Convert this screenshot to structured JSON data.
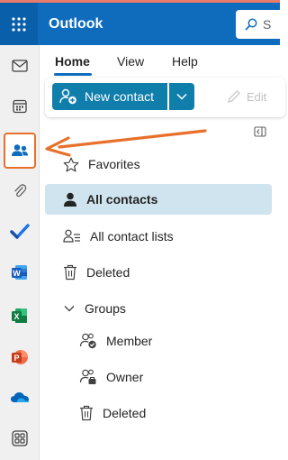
{
  "app": {
    "title": "Outlook"
  },
  "search": {
    "placeholder": "S"
  },
  "colors": {
    "brand": "#0f6cbd",
    "accent_button": "#0f7eab",
    "selected_bg": "#cfe4ee",
    "annotation": "#e8702a"
  },
  "rail": {
    "items": [
      {
        "icon": "mail-icon"
      },
      {
        "icon": "calendar-icon"
      },
      {
        "icon": "people-icon",
        "active": true
      },
      {
        "icon": "attachment-icon"
      },
      {
        "icon": "todo-icon"
      },
      {
        "icon": "word-icon",
        "letter": "W"
      },
      {
        "icon": "excel-icon",
        "letter": "X"
      },
      {
        "icon": "powerpoint-icon",
        "letter": "P"
      },
      {
        "icon": "onedrive-icon"
      },
      {
        "icon": "more-apps-icon"
      }
    ]
  },
  "tabs": [
    {
      "label": "Home",
      "active": true
    },
    {
      "label": "View"
    },
    {
      "label": "Help"
    }
  ],
  "ribbon": {
    "new_contact": "New contact",
    "edit": "Edit"
  },
  "nav": {
    "favorites": "Favorites",
    "all_contacts": "All contacts",
    "all_contact_lists": "All contact lists",
    "deleted": "Deleted",
    "groups": "Groups",
    "member": "Member",
    "owner": "Owner",
    "groups_deleted": "Deleted"
  }
}
